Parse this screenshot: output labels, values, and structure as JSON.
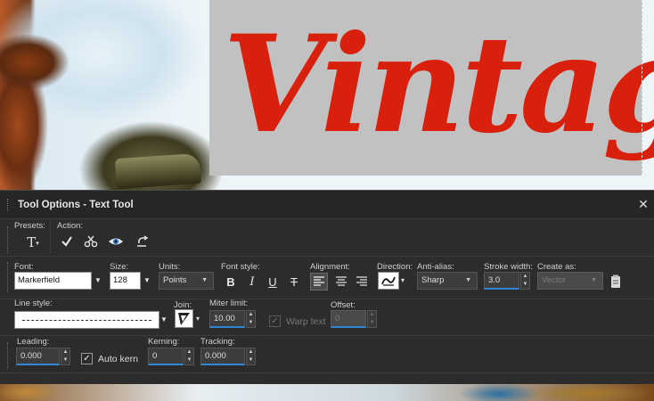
{
  "panel": {
    "title": "Tool Options - Text Tool",
    "close_label": "✕"
  },
  "presets": {
    "label": "Presets:",
    "icon": "text-tool-icon",
    "glyph": "T"
  },
  "action": {
    "label": "Action:",
    "buttons": [
      "apply-checkmark-icon",
      "cut-scissors-icon",
      "eye-view-icon",
      "undo-curve-icon"
    ]
  },
  "font": {
    "label": "Font:",
    "value": "Markerfield"
  },
  "size": {
    "label": "Size:",
    "value": "128"
  },
  "units": {
    "label": "Units:",
    "value": "Points"
  },
  "font_style": {
    "label": "Font style:",
    "bold": "B",
    "italic": "I",
    "underline": "U",
    "strikethrough": "T"
  },
  "alignment": {
    "label": "Alignment:",
    "selected": "left"
  },
  "direction": {
    "label": "Direction:"
  },
  "anti_alias": {
    "label": "Anti-alias:",
    "value": "Sharp"
  },
  "stroke_width": {
    "label": "Stroke width:",
    "value": "3.0"
  },
  "create_as": {
    "label": "Create as:",
    "value": "Vector"
  },
  "line_style": {
    "label": "Line style:"
  },
  "join": {
    "label": "Join:"
  },
  "miter_limit": {
    "label": "Miter limit:",
    "value": "10.00"
  },
  "warp_text": {
    "label": "Warp text",
    "checked": true,
    "enabled": false
  },
  "offset": {
    "label": "Offset:",
    "value": "0"
  },
  "leading": {
    "label": "Leading:",
    "value": "0.000"
  },
  "auto_kern": {
    "label": "Auto kern",
    "checked": true
  },
  "kerning": {
    "label": "Kerning:",
    "value": "0"
  },
  "tracking": {
    "label": "Tracking:",
    "value": "0.000"
  },
  "canvas": {
    "text": "Vintage",
    "text_color": "#d8200c"
  }
}
